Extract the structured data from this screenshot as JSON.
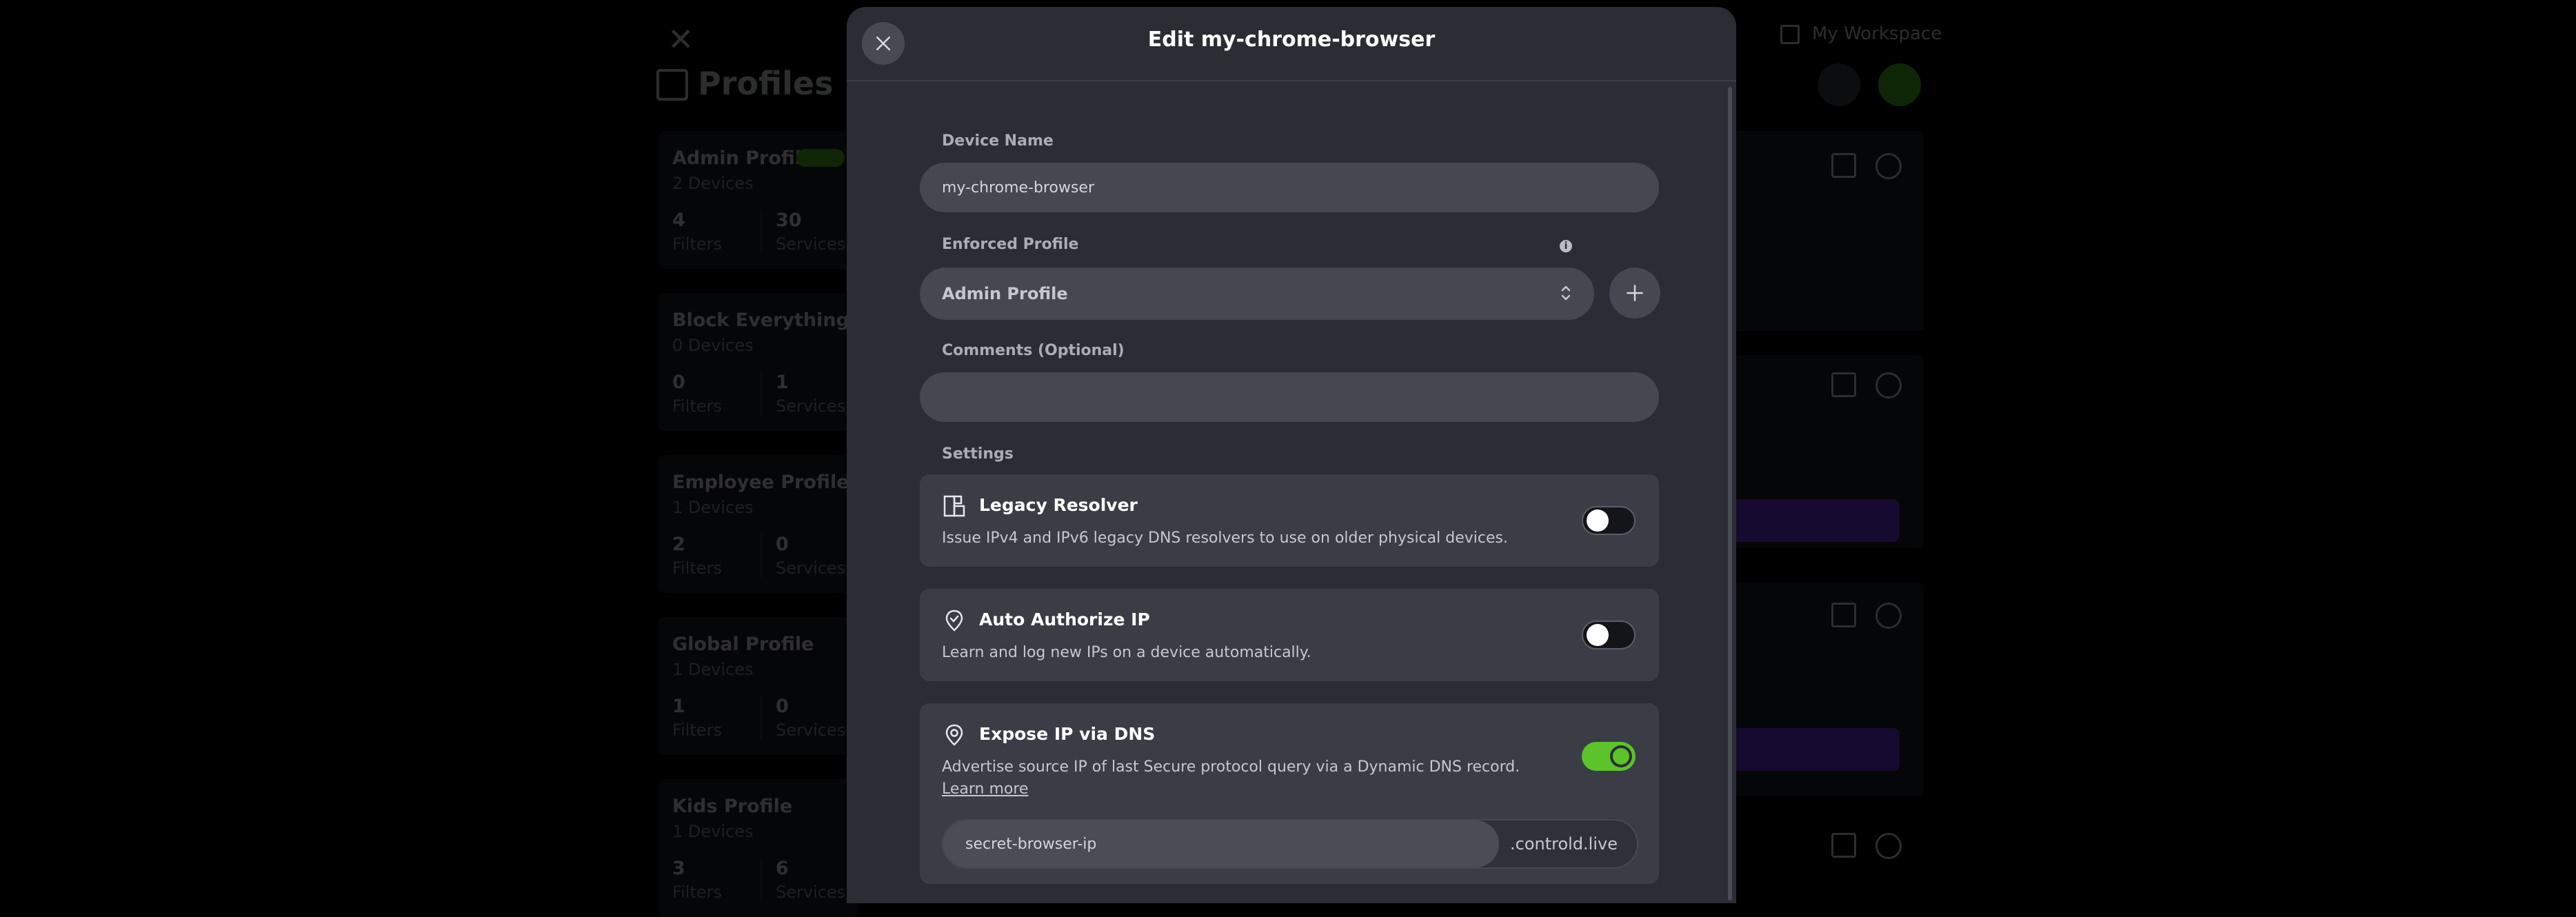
{
  "background": {
    "workspace_label": "My Workspace",
    "page_title": "Profiles",
    "profiles": [
      {
        "name": "Admin Profile",
        "devices": "2 Devices",
        "filters_count": "4",
        "filters_label": "Filters",
        "services_count": "30",
        "services_label": "Services"
      },
      {
        "name": "Block Everything",
        "devices": "0 Devices",
        "filters_count": "0",
        "filters_label": "Filters",
        "services_count": "1",
        "services_label": "Services"
      },
      {
        "name": "Employee Profile",
        "devices": "1 Devices",
        "filters_count": "2",
        "filters_label": "Filters",
        "services_count": "0",
        "services_label": "Services"
      },
      {
        "name": "Global Profile",
        "devices": "1 Devices",
        "filters_count": "1",
        "filters_label": "Filters",
        "services_count": "0",
        "services_label": "Services"
      },
      {
        "name": "Kids Profile",
        "devices": "1 Devices",
        "filters_count": "3",
        "filters_label": "Filters",
        "services_count": "6",
        "services_label": "Services"
      }
    ]
  },
  "modal": {
    "title": "Edit my-chrome-browser",
    "device_name_label": "Device Name",
    "device_name_value": "my-chrome-browser",
    "enforced_profile_label": "Enforced Profile",
    "enforced_profile_value": "Admin Profile",
    "comments_label": "Comments (Optional)",
    "comments_value": "",
    "settings_label": "Settings",
    "settings": [
      {
        "title": "Legacy Resolver",
        "description": "Issue IPv4 and IPv6 legacy DNS resolvers to use on older physical devices.",
        "enabled": false
      },
      {
        "title": "Auto Authorize IP",
        "description": "Learn and log new IPs on a device automatically.",
        "enabled": false
      },
      {
        "title": "Expose IP via DNS",
        "description": "Advertise source IP of last Secure protocol query via a Dynamic DNS record.",
        "link": "Learn more",
        "enabled": true,
        "hostname_value": "secret-browser-ip",
        "hostname_suffix": ".controld.live"
      }
    ]
  },
  "colors": {
    "modal_bg": "#2b2d35",
    "input_bg": "#454851",
    "toggle_on": "#5cc32a",
    "accent_purple": "#6b2fd9"
  }
}
